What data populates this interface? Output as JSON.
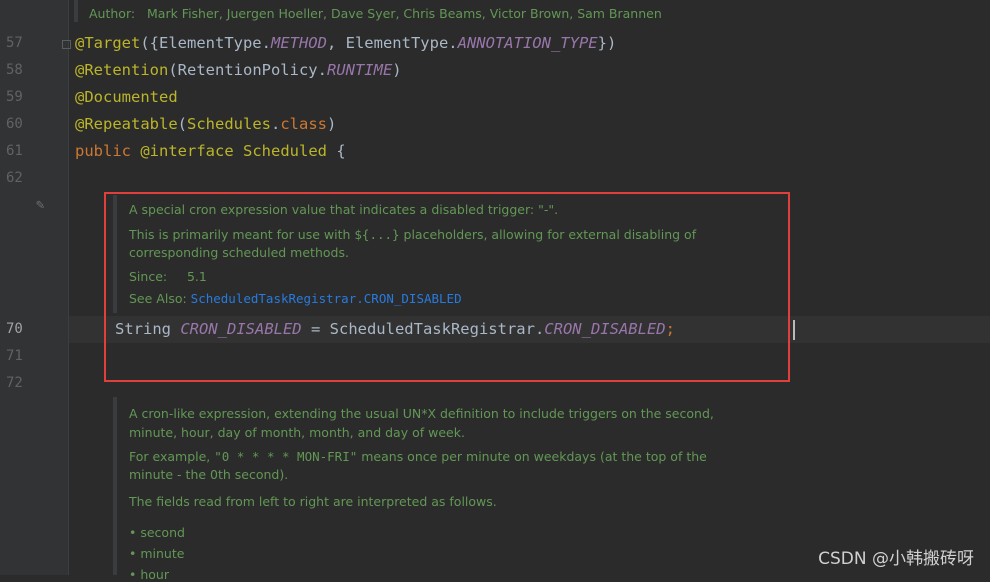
{
  "editor": {
    "author_doc": {
      "label": "Author:",
      "value": "Mark Fisher, Juergen Hoeller, Dave Syer, Chris Beams, Victor Brown, Sam Brannen"
    },
    "line_numbers": [
      "57",
      "58",
      "59",
      "60",
      "61",
      "62",
      "70",
      "71",
      "72"
    ],
    "code": {
      "l57": {
        "ann": "@Target",
        "p1": "({ElementType.",
        "f1": "METHOD",
        "p2": ", ElementType.",
        "f2": "ANNOTATION_TYPE",
        "p3": "})"
      },
      "l58": {
        "ann": "@Retention",
        "p1": "(RetentionPolicy.",
        "f1": "RUNTIME",
        "p2": ")"
      },
      "l59": {
        "ann": "@Documented"
      },
      "l60": {
        "ann": "@Repeatable",
        "p1": "(",
        "cls": "Schedules",
        "p2": ".",
        "kw": "class",
        "p3": ")"
      },
      "l61": {
        "kw1": "public",
        "sp": " ",
        "ann": "@interface",
        "sp2": " ",
        "name": "Scheduled",
        "p1": " {"
      },
      "l70": {
        "t1": "String ",
        "f1": "CRON_DISABLED",
        "t2": " = ScheduledTaskRegistrar.",
        "f2": "CRON_DISABLED",
        "semi": ";"
      }
    },
    "doc1": {
      "line1": "A special cron expression value that indicates a disabled trigger: \"-\".",
      "line2_a": "This is primarily meant for use with ",
      "line2_code": "${...}",
      "line2_b": " placeholders, allowing for external disabling of",
      "line3": "corresponding scheduled methods.",
      "since_label": "Since:",
      "since_value": "5.1",
      "see_label": "See Also:",
      "see_link": "ScheduledTaskRegistrar.CRON_DISABLED"
    },
    "doc2": {
      "p1_l1": "A cron-like expression, extending the usual UN*X definition to include triggers on the second,",
      "p1_l2": "minute, hour, day of month, month, and day of week.",
      "p2_a": "For example, ",
      "p2_code": "\"0 * * * * MON-FRI\"",
      "p2_b": " means once per minute on weekdays (at the top of the",
      "p2_l2": "minute - the 0th second).",
      "p3": "The fields read from left to right are interpreted as follows.",
      "bullets": [
        "second",
        "minute",
        "hour"
      ]
    },
    "watermark": "CSDN @小韩搬砖呀",
    "colors": {
      "highlight_box": "#e0403b",
      "doc_text": "#629755",
      "annotation": "#bbb529",
      "keyword": "#cc7832",
      "field": "#9876aa"
    }
  }
}
